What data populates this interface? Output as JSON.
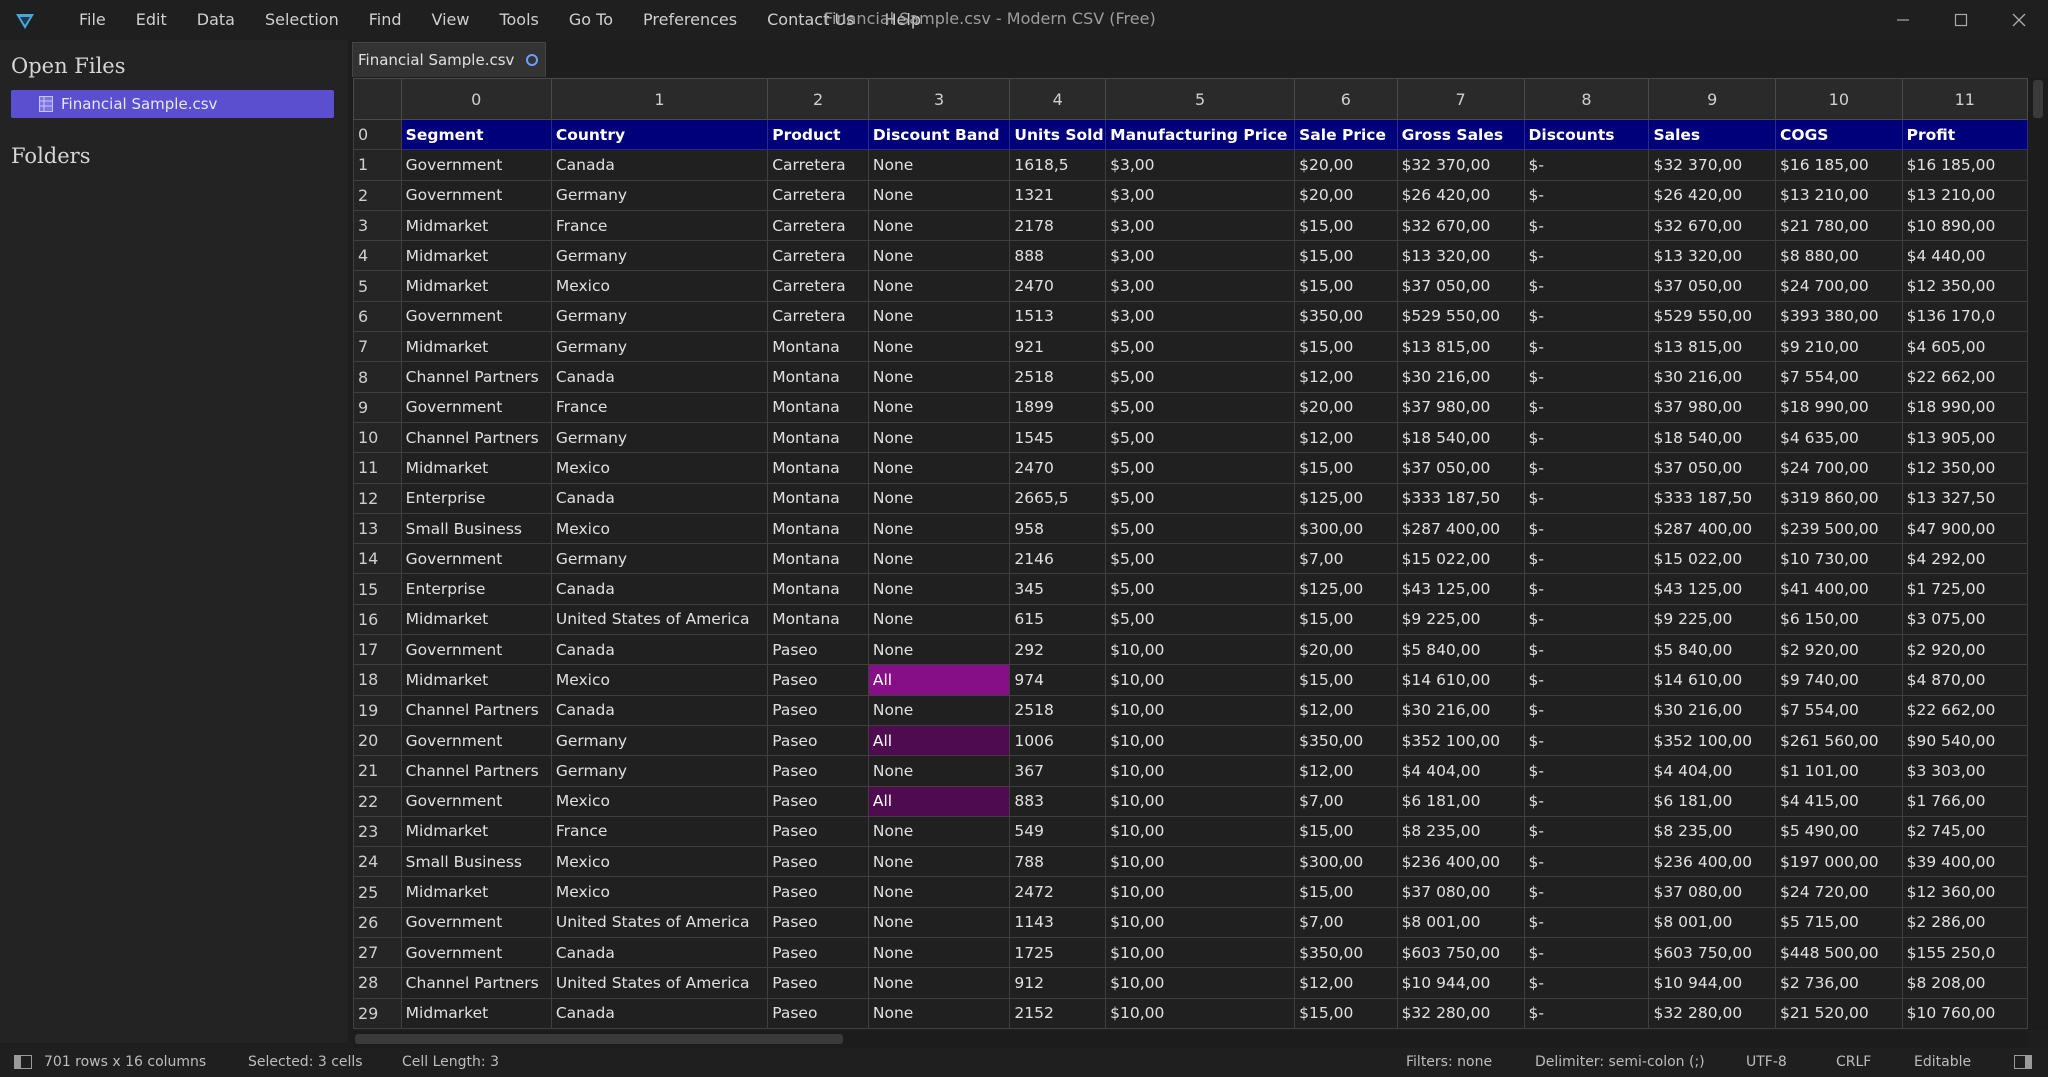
{
  "app": {
    "window_title": "Financial Sample.csv - Modern CSV (Free)",
    "menu": [
      "File",
      "Edit",
      "Data",
      "Selection",
      "Find",
      "View",
      "Tools",
      "Go To",
      "Preferences",
      "Contact Us",
      "Help"
    ]
  },
  "sidebar": {
    "open_files_heading": "Open Files",
    "open_file": "Financial Sample.csv",
    "folders_heading": "Folders"
  },
  "tab": {
    "label": "Financial Sample.csv"
  },
  "grid": {
    "column_indices": [
      "0",
      "1",
      "2",
      "3",
      "4",
      "5",
      "6",
      "7",
      "8",
      "9",
      "10",
      "11"
    ],
    "rows": [
      {
        "n": "0",
        "c": [
          "Segment",
          "Country",
          "Product",
          "Discount Band",
          "Units Sold",
          "Manufacturing Price",
          "Sale Price",
          "Gross Sales",
          "Discounts",
          "Sales",
          "COGS",
          "Profit"
        ]
      },
      {
        "n": "1",
        "c": [
          "Government",
          "Canada",
          "Carretera",
          "None",
          "1618,5",
          "$3,00",
          "$20,00",
          "$32 370,00",
          "$-",
          "$32 370,00",
          "$16 185,00",
          "$16 185,00"
        ]
      },
      {
        "n": "2",
        "c": [
          "Government",
          "Germany",
          "Carretera",
          "None",
          "1321",
          "$3,00",
          "$20,00",
          "$26 420,00",
          "$-",
          "$26 420,00",
          "$13 210,00",
          "$13 210,00"
        ]
      },
      {
        "n": "3",
        "c": [
          "Midmarket",
          "France",
          "Carretera",
          "None",
          "2178",
          "$3,00",
          "$15,00",
          "$32 670,00",
          "$-",
          "$32 670,00",
          "$21 780,00",
          "$10 890,00"
        ]
      },
      {
        "n": "4",
        "c": [
          "Midmarket",
          "Germany",
          "Carretera",
          "None",
          "888",
          "$3,00",
          "$15,00",
          "$13 320,00",
          "$-",
          "$13 320,00",
          "$8 880,00",
          "$4 440,00"
        ]
      },
      {
        "n": "5",
        "c": [
          "Midmarket",
          "Mexico",
          "Carretera",
          "None",
          "2470",
          "$3,00",
          "$15,00",
          "$37 050,00",
          "$-",
          "$37 050,00",
          "$24 700,00",
          "$12 350,00"
        ]
      },
      {
        "n": "6",
        "c": [
          "Government",
          "Germany",
          "Carretera",
          "None",
          "1513",
          "$3,00",
          "$350,00",
          "$529 550,00",
          "$-",
          "$529 550,00",
          "$393 380,00",
          "$136 170,0"
        ]
      },
      {
        "n": "7",
        "c": [
          "Midmarket",
          "Germany",
          "Montana",
          "None",
          "921",
          "$5,00",
          "$15,00",
          "$13 815,00",
          "$-",
          "$13 815,00",
          "$9 210,00",
          "$4 605,00"
        ]
      },
      {
        "n": "8",
        "c": [
          "Channel Partners",
          "Canada",
          "Montana",
          "None",
          "2518",
          "$5,00",
          "$12,00",
          "$30 216,00",
          "$-",
          "$30 216,00",
          "$7 554,00",
          "$22 662,00"
        ]
      },
      {
        "n": "9",
        "c": [
          "Government",
          "France",
          "Montana",
          "None",
          "1899",
          "$5,00",
          "$20,00",
          "$37 980,00",
          "$-",
          "$37 980,00",
          "$18 990,00",
          "$18 990,00"
        ]
      },
      {
        "n": "10",
        "c": [
          "Channel Partners",
          "Germany",
          "Montana",
          "None",
          "1545",
          "$5,00",
          "$12,00",
          "$18 540,00",
          "$-",
          "$18 540,00",
          "$4 635,00",
          "$13 905,00"
        ]
      },
      {
        "n": "11",
        "c": [
          "Midmarket",
          "Mexico",
          "Montana",
          "None",
          "2470",
          "$5,00",
          "$15,00",
          "$37 050,00",
          "$-",
          "$37 050,00",
          "$24 700,00",
          "$12 350,00"
        ]
      },
      {
        "n": "12",
        "c": [
          "Enterprise",
          "Canada",
          "Montana",
          "None",
          "2665,5",
          "$5,00",
          "$125,00",
          "$333 187,50",
          "$-",
          "$333 187,50",
          "$319 860,00",
          "$13 327,50"
        ]
      },
      {
        "n": "13",
        "c": [
          "Small Business",
          "Mexico",
          "Montana",
          "None",
          "958",
          "$5,00",
          "$300,00",
          "$287 400,00",
          "$-",
          "$287 400,00",
          "$239 500,00",
          "$47 900,00"
        ]
      },
      {
        "n": "14",
        "c": [
          "Government",
          "Germany",
          "Montana",
          "None",
          "2146",
          "$5,00",
          "$7,00",
          "$15 022,00",
          "$-",
          "$15 022,00",
          "$10 730,00",
          "$4 292,00"
        ]
      },
      {
        "n": "15",
        "c": [
          "Enterprise",
          "Canada",
          "Montana",
          "None",
          "345",
          "$5,00",
          "$125,00",
          "$43 125,00",
          "$-",
          "$43 125,00",
          "$41 400,00",
          "$1 725,00"
        ]
      },
      {
        "n": "16",
        "c": [
          "Midmarket",
          "United States of America",
          "Montana",
          "None",
          "615",
          "$5,00",
          "$15,00",
          "$9 225,00",
          "$-",
          "$9 225,00",
          "$6 150,00",
          "$3 075,00"
        ]
      },
      {
        "n": "17",
        "c": [
          "Government",
          "Canada",
          "Paseo",
          "None",
          "292",
          "$10,00",
          "$20,00",
          "$5 840,00",
          "$-",
          "$5 840,00",
          "$2 920,00",
          "$2 920,00"
        ]
      },
      {
        "n": "18",
        "c": [
          "Midmarket",
          "Mexico",
          "Paseo",
          "All",
          "974",
          "$10,00",
          "$15,00",
          "$14 610,00",
          "$-",
          "$14 610,00",
          "$9 740,00",
          "$4 870,00"
        ]
      },
      {
        "n": "19",
        "c": [
          "Channel Partners",
          "Canada",
          "Paseo",
          "None",
          "2518",
          "$10,00",
          "$12,00",
          "$30 216,00",
          "$-",
          "$30 216,00",
          "$7 554,00",
          "$22 662,00"
        ]
      },
      {
        "n": "20",
        "c": [
          "Government",
          "Germany",
          "Paseo",
          "All",
          "1006",
          "$10,00",
          "$350,00",
          "$352 100,00",
          "$-",
          "$352 100,00",
          "$261 560,00",
          "$90 540,00"
        ]
      },
      {
        "n": "21",
        "c": [
          "Channel Partners",
          "Germany",
          "Paseo",
          "None",
          "367",
          "$10,00",
          "$12,00",
          "$4 404,00",
          "$-",
          "$4 404,00",
          "$1 101,00",
          "$3 303,00"
        ]
      },
      {
        "n": "22",
        "c": [
          "Government",
          "Mexico",
          "Paseo",
          "All",
          "883",
          "$10,00",
          "$7,00",
          "$6 181,00",
          "$-",
          "$6 181,00",
          "$4 415,00",
          "$1 766,00"
        ]
      },
      {
        "n": "23",
        "c": [
          "Midmarket",
          "France",
          "Paseo",
          "None",
          "549",
          "$10,00",
          "$15,00",
          "$8 235,00",
          "$-",
          "$8 235,00",
          "$5 490,00",
          "$2 745,00"
        ]
      },
      {
        "n": "24",
        "c": [
          "Small Business",
          "Mexico",
          "Paseo",
          "None",
          "788",
          "$10,00",
          "$300,00",
          "$236 400,00",
          "$-",
          "$236 400,00",
          "$197 000,00",
          "$39 400,00"
        ]
      },
      {
        "n": "25",
        "c": [
          "Midmarket",
          "Mexico",
          "Paseo",
          "None",
          "2472",
          "$10,00",
          "$15,00",
          "$37 080,00",
          "$-",
          "$37 080,00",
          "$24 720,00",
          "$12 360,00"
        ]
      },
      {
        "n": "26",
        "c": [
          "Government",
          "United States of America",
          "Paseo",
          "None",
          "1143",
          "$10,00",
          "$7,00",
          "$8 001,00",
          "$-",
          "$8 001,00",
          "$5 715,00",
          "$2 286,00"
        ]
      },
      {
        "n": "27",
        "c": [
          "Government",
          "Canada",
          "Paseo",
          "None",
          "1725",
          "$10,00",
          "$350,00",
          "$603 750,00",
          "$-",
          "$603 750,00",
          "$448 500,00",
          "$155 250,0"
        ]
      },
      {
        "n": "28",
        "c": [
          "Channel Partners",
          "United States of America",
          "Paseo",
          "None",
          "912",
          "$10,00",
          "$12,00",
          "$10 944,00",
          "$-",
          "$10 944,00",
          "$2 736,00",
          "$8 208,00"
        ]
      },
      {
        "n": "29",
        "c": [
          "Midmarket",
          "Canada",
          "Paseo",
          "None",
          "2152",
          "$10,00",
          "$15,00",
          "$32 280,00",
          "$-",
          "$32 280,00",
          "$21 520,00",
          "$10 760,00"
        ]
      }
    ]
  },
  "colors": {
    "header_row_bg": "#00007a",
    "selected_file_bg": "#5b4fd0",
    "selection_primary": "#860e86",
    "selection_secondary": "#4f0b4f"
  },
  "status": {
    "size": "701 rows x 16 columns",
    "selected": "Selected: 3 cells",
    "cell_length": "Cell Length: 3",
    "filters": "Filters: none",
    "delimiter": "Delimiter: semi-colon (;)",
    "encoding": "UTF-8",
    "line_ending": "CRLF",
    "mode": "Editable"
  }
}
